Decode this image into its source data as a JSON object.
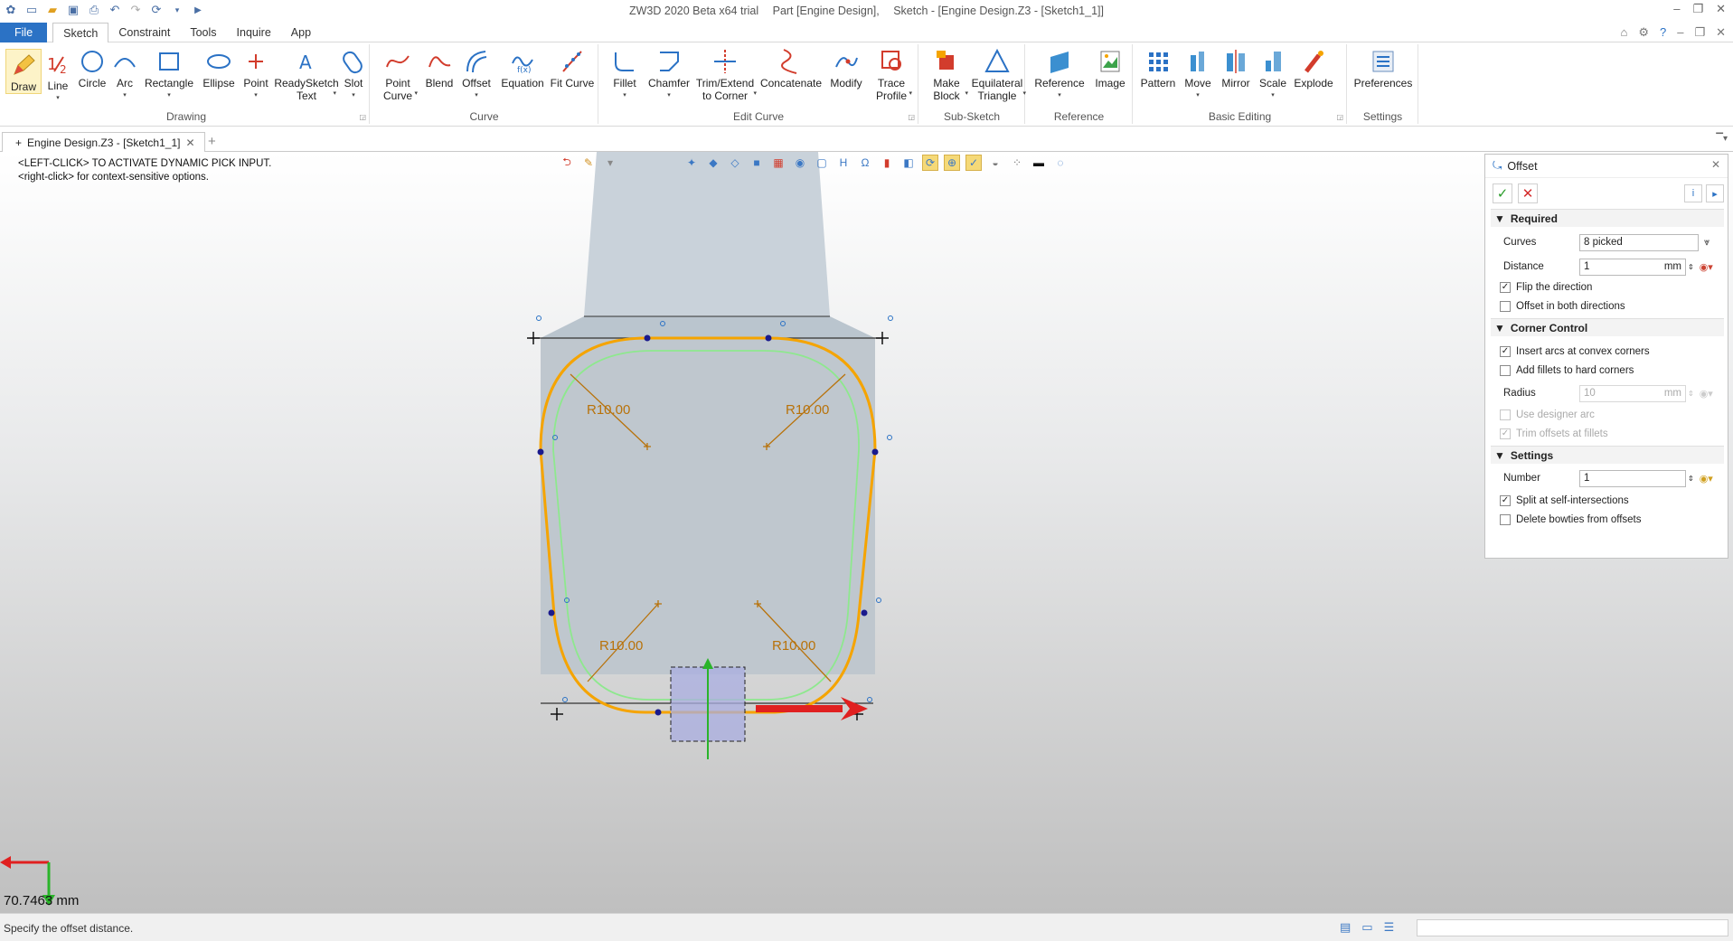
{
  "window": {
    "title_parts": [
      "ZW3D 2020 Beta x64 trial",
      "Part [Engine Design],",
      "Sketch - [Engine Design.Z3 - [Sketch1_1]]"
    ]
  },
  "menu": {
    "items": [
      "File",
      "Sketch",
      "Constraint",
      "Tools",
      "Inquire",
      "App"
    ],
    "active": "Sketch"
  },
  "ribbon": {
    "groups": [
      {
        "label": "Drawing",
        "tools": [
          {
            "label": "Draw",
            "icon": "pencil-icon"
          },
          {
            "label": "Line",
            "icon": "line-icon"
          },
          {
            "label": "Circle",
            "icon": "circle-icon"
          },
          {
            "label": "Arc",
            "icon": "arc-icon"
          },
          {
            "label": "Rectangle",
            "icon": "rectangle-icon"
          },
          {
            "label": "Ellipse",
            "icon": "ellipse-icon"
          },
          {
            "label": "Point",
            "icon": "point-icon"
          },
          {
            "label": "ReadySketch\nText",
            "icon": "text-icon"
          },
          {
            "label": "Slot",
            "icon": "slot-icon"
          }
        ]
      },
      {
        "label": "Curve",
        "tools": [
          {
            "label": "Point\nCurve",
            "icon": "point-curve-icon"
          },
          {
            "label": "Blend",
            "icon": "blend-icon"
          },
          {
            "label": "Offset",
            "icon": "offset-icon"
          },
          {
            "label": "Equation",
            "icon": "equation-icon"
          },
          {
            "label": "Fit Curve",
            "icon": "fit-curve-icon"
          }
        ]
      },
      {
        "label": "Edit Curve",
        "tools": [
          {
            "label": "Fillet",
            "icon": "fillet-icon"
          },
          {
            "label": "Chamfer",
            "icon": "chamfer-icon"
          },
          {
            "label": "Trim/Extend\nto Corner",
            "icon": "trim-icon"
          },
          {
            "label": "Concatenate",
            "icon": "concatenate-icon"
          },
          {
            "label": "Modify",
            "icon": "modify-icon"
          },
          {
            "label": "Trace\nProfile",
            "icon": "trace-profile-icon"
          }
        ]
      },
      {
        "label": "Sub-Sketch",
        "tools": [
          {
            "label": "Make\nBlock",
            "icon": "make-block-icon"
          },
          {
            "label": "Equilateral\nTriangle",
            "icon": "triangle-icon"
          }
        ]
      },
      {
        "label": "Reference",
        "tools": [
          {
            "label": "Reference",
            "icon": "reference-icon"
          },
          {
            "label": "Image",
            "icon": "image-icon"
          }
        ]
      },
      {
        "label": "Basic Editing",
        "tools": [
          {
            "label": "Pattern",
            "icon": "pattern-icon"
          },
          {
            "label": "Move",
            "icon": "move-icon"
          },
          {
            "label": "Mirror",
            "icon": "mirror-icon"
          },
          {
            "label": "Scale",
            "icon": "scale-icon"
          },
          {
            "label": "Explode",
            "icon": "explode-icon"
          }
        ]
      },
      {
        "label": "Settings",
        "tools": [
          {
            "label": "Preferences",
            "icon": "preferences-icon"
          }
        ]
      }
    ]
  },
  "doc_tab": {
    "label": "Engine Design.Z3 - [Sketch1_1]"
  },
  "viewport": {
    "prompt_line1": "<LEFT-CLICK> TO ACTIVATE DYNAMIC PICK INPUT.",
    "prompt_line2": "<right-click> for context-sensitive options.",
    "radius_labels": [
      "R10.00",
      "R10.00",
      "R10.00",
      "R10.00"
    ],
    "measure": "70.7463 mm"
  },
  "offset_panel": {
    "title": "Offset",
    "sections": {
      "required": "Required",
      "corner": "Corner Control",
      "settings": "Settings"
    },
    "curves_label": "Curves",
    "curves_value": "8 picked",
    "distance_label": "Distance",
    "distance_value": "1",
    "distance_unit": "mm",
    "flip": {
      "label": "Flip the direction",
      "checked": true
    },
    "both": {
      "label": "Offset in both directions",
      "checked": false
    },
    "insert_arcs": {
      "label": "Insert arcs at convex corners",
      "checked": true
    },
    "add_fillets": {
      "label": "Add fillets to hard corners",
      "checked": false
    },
    "radius_label": "Radius",
    "radius_value": "10",
    "radius_unit": "mm",
    "designer_arc": {
      "label": "Use designer arc",
      "checked": false
    },
    "trim": {
      "label": "Trim offsets at fillets",
      "checked": true
    },
    "number_label": "Number",
    "number_value": "1",
    "split": {
      "label": "Split at self-intersections",
      "checked": true
    },
    "bowties": {
      "label": "Delete bowties from offsets",
      "checked": false
    }
  },
  "status": {
    "text": "Specify the offset distance."
  },
  "colors": {
    "accent": "#2b72c5",
    "profile": "#f5a400",
    "offset_preview": "#8ee88e",
    "dimension": "#b8720a"
  }
}
